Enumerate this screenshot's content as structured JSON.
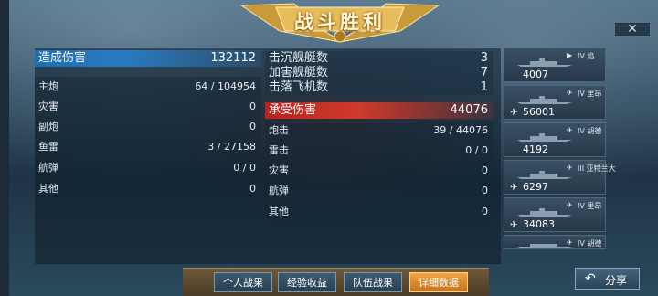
{
  "title": "战斗胜利",
  "close_label": "✕",
  "damage_dealt": {
    "header": {
      "label": "造成伤害",
      "value": "132112"
    },
    "rows": [
      {
        "label": "主炮",
        "value": "64 / 104954"
      },
      {
        "label": "灾害",
        "value": "0"
      },
      {
        "label": "副炮",
        "value": "0"
      },
      {
        "label": "鱼雷",
        "value": "3 / 27158"
      },
      {
        "label": "航弹",
        "value": "0 / 0"
      },
      {
        "label": "其他",
        "value": "0"
      }
    ]
  },
  "kills": [
    {
      "label": "击沉舰艇数",
      "value": "3"
    },
    {
      "label": "加害舰艇数",
      "value": "7"
    },
    {
      "label": "击落飞机数",
      "value": "1"
    }
  ],
  "damage_taken": {
    "header": {
      "label": "承受伤害",
      "value": "44076"
    },
    "rows": [
      {
        "label": "炮击",
        "value": "39 / 44076"
      },
      {
        "label": "雷击",
        "value": "0 / 0"
      },
      {
        "label": "灾害",
        "value": "0"
      },
      {
        "label": "航弹",
        "value": "0"
      },
      {
        "label": "其他",
        "value": "0"
      }
    ]
  },
  "ships": [
    {
      "tier": "IV 焰",
      "damage": "4007",
      "plane": false
    },
    {
      "tier": "IV 里昂",
      "damage": "56001",
      "plane": true
    },
    {
      "tier": "IV 胡德",
      "damage": "4192",
      "plane": false
    },
    {
      "tier": "III 亚特兰大",
      "damage": "6297",
      "plane": true
    },
    {
      "tier": "IV 里昂",
      "damage": "34083",
      "plane": true
    },
    {
      "tier": "IV 胡德",
      "damage": "",
      "plane": false
    }
  ],
  "tabs": [
    {
      "label": "个人战果",
      "active": false
    },
    {
      "label": "经验收益",
      "active": false
    },
    {
      "label": "队伍战果",
      "active": false
    },
    {
      "label": "详细数据",
      "active": true
    }
  ],
  "share_label": "分享",
  "colors": {
    "accent_blue": "#2a7ac0",
    "accent_red": "#d03a2c",
    "active_tab": "#f0a640"
  }
}
